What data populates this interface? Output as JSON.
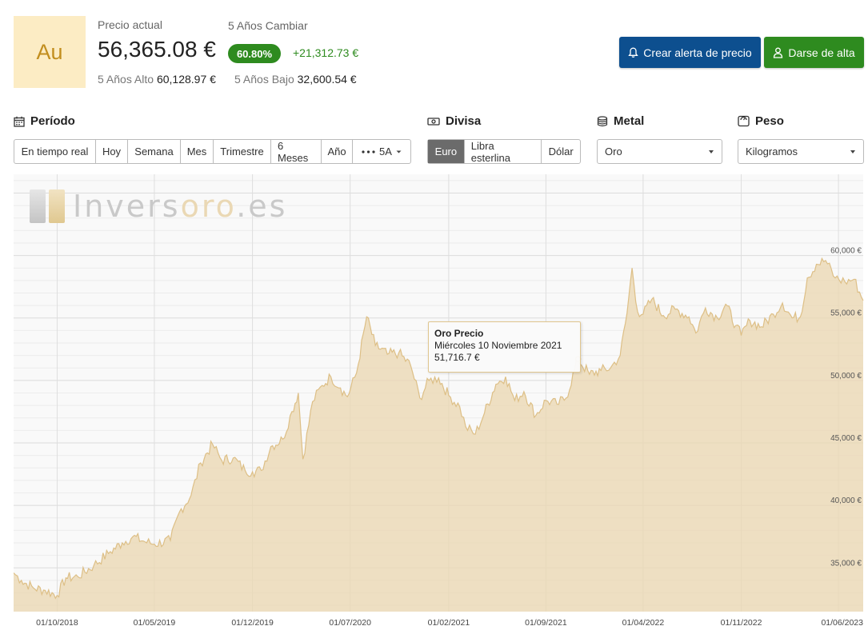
{
  "header": {
    "symbol": "Au",
    "current_label": "Precio actual",
    "current_price": "56,365.08 €",
    "change_label": "5 Años Cambiar",
    "change_pct": "60.80%",
    "change_abs": "+21,312.73 €",
    "high_label": "5 Años Alto",
    "high_value": "60,128.97 €",
    "low_label": "5 Años Bajo",
    "low_value": "32,600.54 €"
  },
  "actions": {
    "alert_label": "Crear alerta de precio",
    "signup_label": "Darse de alta"
  },
  "controls": {
    "period": {
      "title": "Período",
      "options": [
        "En tiempo real",
        "Hoy",
        "Semana",
        "Mes",
        "Trimestre",
        "6 Meses",
        "Año"
      ],
      "more_label": "5A"
    },
    "currency": {
      "title": "Divisa",
      "options": [
        "Euro",
        "Libra esterlina",
        "Dólar"
      ],
      "selected": "Euro"
    },
    "metal": {
      "title": "Metal",
      "selected": "Oro"
    },
    "weight": {
      "title": "Peso",
      "selected": "Kilogramos"
    }
  },
  "watermark": {
    "brand_start": "Invers",
    "brand_oro": "oro",
    "brand_end": ".es"
  },
  "tooltip": {
    "title": "Oro Precio",
    "date": "Miércoles 10 Noviembre 2021",
    "value": "51,716.7 €"
  },
  "colors": {
    "blue_button": "#0d4f8f",
    "green": "#2e8b1f",
    "area_fill": "#ead7b2",
    "area_line": "#ddbf86",
    "symbol_bg": "#fcecc4"
  },
  "chart_data": {
    "type": "area",
    "series_name": "Oro Precio",
    "ylim": [
      31500,
      66500
    ],
    "y_ticks": [
      35000,
      40000,
      45000,
      50000,
      55000,
      60000
    ],
    "y_tick_labels": [
      "35,000 €",
      "40,000 €",
      "45,000 €",
      "50,000 €",
      "55,000 €",
      "60,000 €"
    ],
    "x_labels": [
      "01/10/2018",
      "01/05/2019",
      "01/12/2019",
      "01/07/2020",
      "01/02/2021",
      "01/09/2021",
      "01/04/2022",
      "01/11/2022",
      "01/06/2023"
    ],
    "x_label_dates": [
      "2018-10-01",
      "2019-05-01",
      "2019-12-01",
      "2020-07-01",
      "2021-02-01",
      "2021-09-01",
      "2022-04-01",
      "2022-11-01",
      "2023-06-01"
    ],
    "x_range": [
      "2018-06-28",
      "2023-07-25"
    ],
    "points": [
      [
        "2018-06-28",
        34600
      ],
      [
        "2018-07-15",
        34000
      ],
      [
        "2018-08-10",
        33400
      ],
      [
        "2018-09-05",
        33200
      ],
      [
        "2018-10-01",
        32800
      ],
      [
        "2018-10-20",
        34200
      ],
      [
        "2018-11-15",
        34300
      ],
      [
        "2018-12-20",
        35200
      ],
      [
        "2019-01-25",
        36300
      ],
      [
        "2019-02-20",
        37000
      ],
      [
        "2019-03-15",
        37500
      ],
      [
        "2019-04-10",
        37100
      ],
      [
        "2019-05-01",
        36900
      ],
      [
        "2019-06-05",
        37200
      ],
      [
        "2019-06-25",
        39500
      ],
      [
        "2019-07-20",
        40800
      ],
      [
        "2019-08-10",
        43400
      ],
      [
        "2019-09-05",
        44900
      ],
      [
        "2019-09-25",
        43600
      ],
      [
        "2019-10-20",
        43800
      ],
      [
        "2019-11-15",
        42800
      ],
      [
        "2019-12-01",
        42700
      ],
      [
        "2019-12-20",
        42800
      ],
      [
        "2020-01-10",
        44700
      ],
      [
        "2020-02-05",
        45300
      ],
      [
        "2020-02-25",
        47500
      ],
      [
        "2020-03-10",
        49000
      ],
      [
        "2020-03-20",
        43700
      ],
      [
        "2020-04-10",
        48300
      ],
      [
        "2020-05-01",
        49600
      ],
      [
        "2020-05-20",
        50300
      ],
      [
        "2020-06-10",
        49400
      ],
      [
        "2020-06-25",
        48700
      ],
      [
        "2020-07-15",
        50600
      ],
      [
        "2020-08-06",
        55100
      ],
      [
        "2020-08-25",
        52800
      ],
      [
        "2020-09-20",
        52100
      ],
      [
        "2020-10-15",
        52200
      ],
      [
        "2020-11-10",
        51200
      ],
      [
        "2020-11-30",
        48600
      ],
      [
        "2020-12-20",
        50000
      ],
      [
        "2021-01-10",
        50200
      ],
      [
        "2021-02-01",
        48800
      ],
      [
        "2021-02-25",
        47900
      ],
      [
        "2021-03-10",
        46300
      ],
      [
        "2021-03-31",
        45700
      ],
      [
        "2021-04-20",
        47400
      ],
      [
        "2021-05-15",
        49700
      ],
      [
        "2021-06-05",
        50300
      ],
      [
        "2021-06-25",
        48400
      ],
      [
        "2021-07-15",
        49100
      ],
      [
        "2021-08-10",
        47200
      ],
      [
        "2021-09-01",
        48400
      ],
      [
        "2021-09-25",
        48100
      ],
      [
        "2021-10-15",
        48600
      ],
      [
        "2021-11-10",
        51716.7
      ],
      [
        "2021-12-05",
        50500
      ],
      [
        "2021-12-30",
        50800
      ],
      [
        "2022-01-20",
        51000
      ],
      [
        "2022-02-10",
        52000
      ],
      [
        "2022-02-25",
        55400
      ],
      [
        "2022-03-08",
        59000
      ],
      [
        "2022-03-20",
        55500
      ],
      [
        "2022-04-01",
        55300
      ],
      [
        "2022-04-20",
        56500
      ],
      [
        "2022-05-15",
        55200
      ],
      [
        "2022-06-10",
        55700
      ],
      [
        "2022-07-10",
        55100
      ],
      [
        "2022-07-25",
        53800
      ],
      [
        "2022-08-15",
        55800
      ],
      [
        "2022-09-10",
        55000
      ],
      [
        "2022-09-28",
        56100
      ],
      [
        "2022-10-20",
        54400
      ],
      [
        "2022-11-01",
        53600
      ],
      [
        "2022-11-20",
        54800
      ],
      [
        "2022-12-15",
        54300
      ],
      [
        "2023-01-10",
        55300
      ],
      [
        "2023-01-30",
        56200
      ],
      [
        "2023-02-20",
        55000
      ],
      [
        "2023-03-10",
        55100
      ],
      [
        "2023-03-25",
        58200
      ],
      [
        "2023-04-14",
        59300
      ],
      [
        "2023-05-04",
        59600
      ],
      [
        "2023-05-25",
        58200
      ],
      [
        "2023-06-15",
        57900
      ],
      [
        "2023-07-05",
        58100
      ],
      [
        "2023-07-25",
        56400
      ]
    ]
  }
}
